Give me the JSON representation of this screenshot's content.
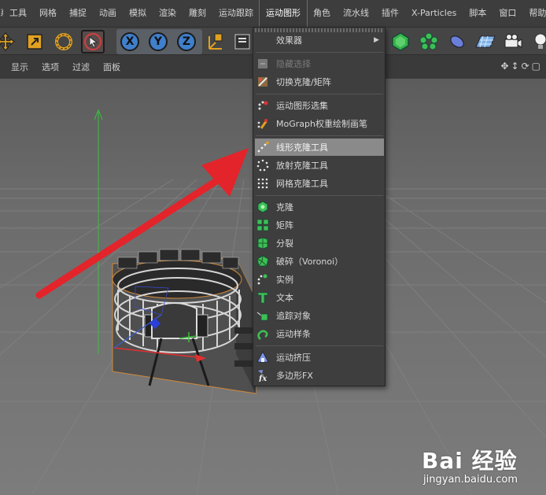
{
  "menubar": {
    "items": [
      "系",
      "工具",
      "网格",
      "捕捉",
      "动画",
      "模拟",
      "渲染",
      "雕刻",
      "运动跟踪",
      "运动图形",
      "角色",
      "流水线",
      "插件",
      "X-Particles",
      "脚本",
      "窗口",
      "帮助"
    ],
    "active": "运动图形"
  },
  "toolbar": {
    "icons": [
      "move-icon",
      "scale-icon",
      "rotate-icon",
      "select-icon",
      "x-axis-lock",
      "y-axis-lock",
      "z-axis-lock",
      "coordinate-system-icon",
      "render-view-icon",
      "mograph-effector-icon",
      "cloner-green-icon",
      "deformer-icon",
      "floor-icon",
      "camera-icon",
      "light-icon"
    ],
    "x_label": "X",
    "y_label": "Y",
    "z_label": "Z"
  },
  "viewport_menu": {
    "items": [
      "显示",
      "选项",
      "过滤",
      "面板"
    ]
  },
  "dropdown": {
    "items": [
      {
        "label": "效果器",
        "icon": "effector-icon",
        "submenu": true
      },
      {
        "label": "隐藏选择",
        "icon": "hide-selection-icon",
        "disabled": true
      },
      {
        "label": "切换克隆/矩阵",
        "icon": "toggle-clone-icon"
      },
      {
        "label": "运动图形选集",
        "icon": "mograph-selection-icon"
      },
      {
        "label": "MoGraph权重绘制画笔",
        "icon": "weight-brush-icon"
      },
      {
        "label": "线形克隆工具",
        "icon": "linear-clone-icon",
        "highlighted": true
      },
      {
        "label": "放射克隆工具",
        "icon": "radial-clone-icon"
      },
      {
        "label": "网格克隆工具",
        "icon": "grid-clone-icon"
      },
      {
        "label": "克隆",
        "icon": "cloner-icon"
      },
      {
        "label": "矩阵",
        "icon": "matrix-icon"
      },
      {
        "label": "分裂",
        "icon": "fracture-icon"
      },
      {
        "label": "破碎（Voronoi）",
        "icon": "voronoi-fracture-icon"
      },
      {
        "label": "实例",
        "icon": "instance-icon"
      },
      {
        "label": "文本",
        "icon": "text-icon"
      },
      {
        "label": "追踪对象",
        "icon": "tracer-icon"
      },
      {
        "label": "运动样条",
        "icon": "mospline-icon"
      },
      {
        "label": "运动挤压",
        "icon": "moextrude-icon"
      },
      {
        "label": "多边形FX",
        "icon": "polyfx-icon"
      }
    ]
  },
  "watermark": {
    "logo": "Bai 经验",
    "url": "jingyan.baidu.com"
  },
  "colors": {
    "menubar_bg": "#3d3d3d",
    "dropdown_bg": "#3e3e3e",
    "highlight": "#8a8a8a",
    "arrow": "#e3242b",
    "axis_x": "#e03030",
    "axis_y": "#3cc040",
    "object_outline": "#d28a3a"
  }
}
